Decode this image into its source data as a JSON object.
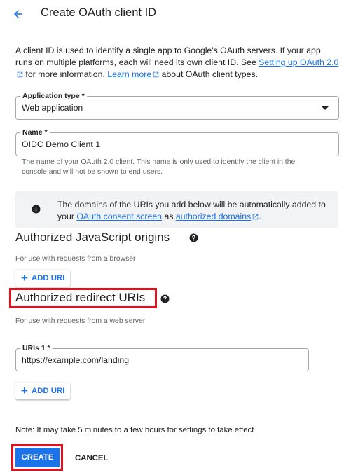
{
  "header": {
    "title": "Create OAuth client ID"
  },
  "intro": {
    "text_before": "A client ID is used to identify a single app to Google's OAuth servers. If your app runs on multiple platforms, each will need its own client ID. See ",
    "link1": "Setting up OAuth 2.0",
    "text_middle": " for more information. ",
    "link2": "Learn more",
    "text_after": " about OAuth client types."
  },
  "application_type": {
    "label": "Application type *",
    "value": "Web application"
  },
  "name_field": {
    "label": "Name *",
    "value": "OIDC Demo Client 1",
    "hint": "The name of your OAuth 2.0 client. This name is only used to identify the client in the console and will not be shown to end users."
  },
  "info": {
    "text_before": "The domains of the URIs you add below will be automatically added to your ",
    "link1": "OAuth consent screen",
    "text_middle": " as ",
    "link2": "authorized domains",
    "text_after": "."
  },
  "js_origins": {
    "title": "Authorized JavaScript origins",
    "subtitle": "For use with requests from a browser",
    "add_label": "ADD URI"
  },
  "redirect_uris": {
    "title": "Authorized redirect URIs",
    "subtitle": "For use with requests from a web server",
    "uri_label": "URIs 1 *",
    "uri_value": "https://example.com/landing",
    "add_label": "ADD URI"
  },
  "note": "Note: It may take 5 minutes to a few hours for settings to take effect",
  "actions": {
    "create": "CREATE",
    "cancel": "CANCEL"
  },
  "colors": {
    "accent": "#1a73e8",
    "highlight": "#e0101c"
  },
  "icons": [
    "arrow-back-icon",
    "external-link-icon",
    "dropdown-caret-icon",
    "info-icon",
    "help-icon",
    "plus-icon"
  ]
}
